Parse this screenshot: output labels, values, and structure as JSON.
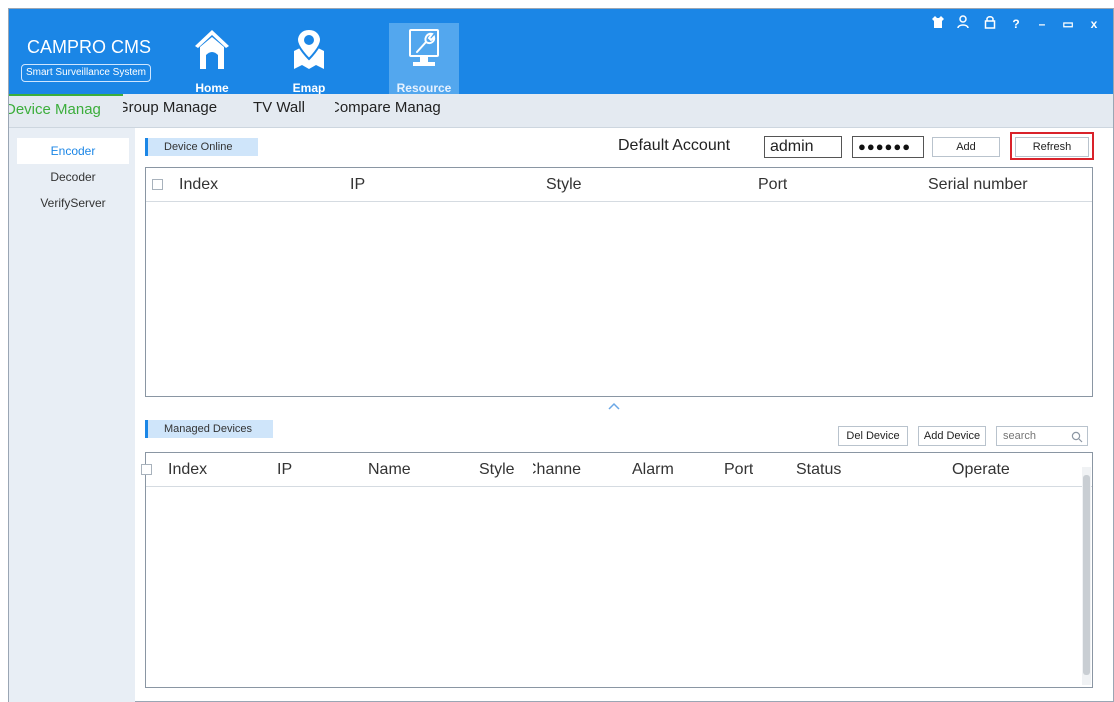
{
  "app": {
    "title": "CAMPRO CMS",
    "subtitle": "Smart Surveillance System"
  },
  "nav": {
    "home": "Home",
    "emap": "Emap",
    "resource": "Resource",
    "active": "Resource"
  },
  "window_controls": {
    "skin": "skin-icon",
    "user": "user-icon",
    "lock": "lock-icon",
    "help": "?",
    "minimize": "–",
    "maximize": "▭",
    "close": "x"
  },
  "tabs": [
    "Device Manag",
    "Group Manage",
    "TV Wall",
    "Compare Manag"
  ],
  "active_tab": "Device Manag",
  "sidebar": {
    "items": [
      "Encoder",
      "Decoder",
      "VerifyServer"
    ],
    "active": "Encoder"
  },
  "online": {
    "label": "Device Online",
    "account_label": "Default Account",
    "account_user": "admin",
    "account_password": "●●●●●●",
    "add_label": "Add",
    "refresh_label": "Refresh",
    "columns": [
      "Index",
      "IP",
      "Style",
      "Port",
      "Serial number"
    ],
    "rows": []
  },
  "managed": {
    "label": "Managed Devices",
    "del_label": "Del Device",
    "add_label": "Add Device",
    "search_placeholder": "search",
    "columns": [
      "Index",
      "IP",
      "Name",
      "Style",
      "Channe",
      "Alarm",
      "Port",
      "Status",
      "Operate"
    ],
    "rows": []
  },
  "colors": {
    "header": "#1b86e6",
    "active_tab": "#3cae3c",
    "highlight_box": "#d9222a"
  }
}
